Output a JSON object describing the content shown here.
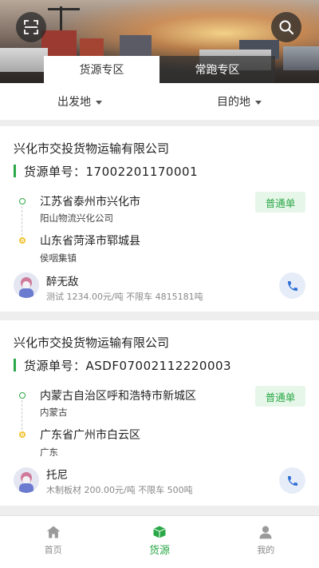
{
  "header": {
    "tabs": [
      {
        "label": "货源专区",
        "active": true
      },
      {
        "label": "常跑专区",
        "active": false
      }
    ]
  },
  "filters": {
    "origin_label": "出发地",
    "destination_label": "目的地"
  },
  "listings": [
    {
      "company": "兴化市交投货物运输有限公司",
      "order_number": "货源单号：17002201170001",
      "from_place": "江苏省泰州市兴化市",
      "from_detail": "阳山物流兴化公司",
      "to_place": "山东省菏泽市郓城县",
      "to_detail": "侯咽集镇",
      "badge": "普通单",
      "user_name": "醉无敌",
      "cargo_info": "测试 1234.00元/吨 不限车 4815181吨"
    },
    {
      "company": "兴化市交投货物运输有限公司",
      "order_number": "货源单号：ASDF07002112220003",
      "from_place": "内蒙古自治区呼和浩特市新城区",
      "from_detail": "内蒙古",
      "to_place": "广东省广州市白云区",
      "to_detail": "广东",
      "badge": "普通单",
      "user_name": "托尼",
      "cargo_info": "木制板材 200.00元/吨 不限车 500吨"
    }
  ],
  "bottom_nav": [
    {
      "label": "首页",
      "icon": "home-icon",
      "active": false
    },
    {
      "label": "货源",
      "icon": "cargo-box-icon",
      "active": true
    },
    {
      "label": "我的",
      "icon": "person-icon",
      "active": false
    }
  ],
  "colors": {
    "accent": "#2aa847",
    "badge_bg": "#e6f6e8",
    "origin_dot": "#2aa847",
    "destination_dot": "#f2c230"
  }
}
